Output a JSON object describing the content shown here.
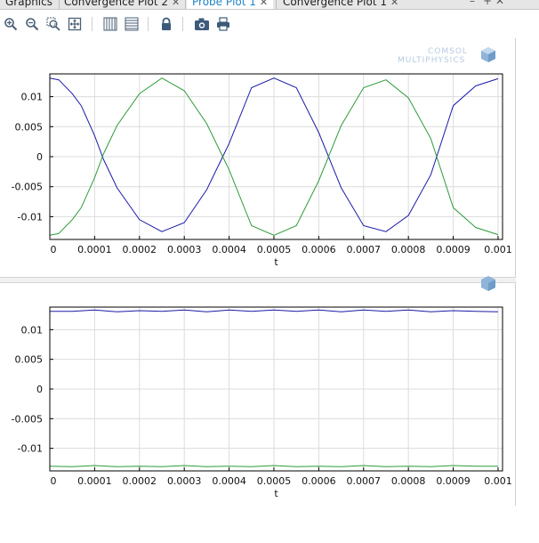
{
  "tabs": [
    {
      "label": "Graphics",
      "closable": false,
      "active": false
    },
    {
      "label": "Convergence Plot 2",
      "closable": true,
      "active": false
    },
    {
      "label": "Probe Plot 1",
      "closable": true,
      "active": true
    },
    {
      "label": "Convergence Plot 1",
      "closable": true,
      "active": false
    }
  ],
  "toolbar": {
    "icons": [
      "zoom-in-icon",
      "zoom-out-icon",
      "zoom-box-icon",
      "zoom-extents-icon",
      "x-grid-icon",
      "y-grid-icon",
      "lock-icon",
      "camera-icon",
      "print-icon"
    ]
  },
  "logo": {
    "line1": "COMSOL",
    "line2": "MULTIPHYSICS"
  },
  "colors": {
    "series1": "#1a1aa8",
    "series2": "#2e9b3a",
    "grid": "#dcdcdc",
    "accent": "#1d83c5"
  },
  "chart_data": [
    {
      "type": "line",
      "xlabel": "t",
      "ylabel": "",
      "xlim": [
        0,
        0.00101
      ],
      "ylim": [
        -0.0138,
        0.0138
      ],
      "xticks": [
        "0",
        "0.0001",
        "0.0002",
        "0.0003",
        "0.0004",
        "0.0005",
        "0.0006",
        "0.0007",
        "0.0008",
        "0.0009",
        "0.001"
      ],
      "yticks": [
        "0.01",
        "0.005",
        "0",
        "-0.005",
        "-0.01"
      ],
      "grid": true,
      "x": [
        0,
        2e-05,
        5e-05,
        7e-05,
        0.0001,
        0.00012,
        0.00015,
        0.0002,
        0.00025,
        0.0003,
        0.00035,
        0.0004,
        0.00045,
        0.0005,
        0.00055,
        0.0006,
        0.00065,
        0.0007,
        0.00075,
        0.0008,
        0.00085,
        0.0009,
        0.00095,
        0.001
      ],
      "series": [
        {
          "name": "",
          "color": "#1a1aa8",
          "values": [
            0.0131,
            0.0128,
            0.0105,
            0.0085,
            0.0035,
            -0.0005,
            -0.0052,
            -0.0105,
            -0.0125,
            -0.011,
            -0.0055,
            0.0022,
            0.0115,
            0.0131,
            0.0115,
            0.004,
            -0.0052,
            -0.0115,
            -0.0125,
            -0.0098,
            -0.003,
            0.0085,
            0.0118,
            0.013
          ]
        },
        {
          "name": "",
          "color": "#2e9b3a",
          "values": [
            -0.0131,
            -0.0128,
            -0.0105,
            -0.0085,
            -0.0035,
            0.0005,
            0.0052,
            0.0105,
            0.0131,
            0.011,
            0.0055,
            -0.0022,
            -0.0115,
            -0.0131,
            -0.0115,
            -0.004,
            0.0052,
            0.0115,
            0.0128,
            0.0098,
            0.003,
            -0.0085,
            -0.0118,
            -0.013
          ]
        }
      ]
    },
    {
      "type": "line",
      "xlabel": "t",
      "ylabel": "",
      "xlim": [
        0,
        0.00101
      ],
      "ylim": [
        -0.0138,
        0.0138
      ],
      "xticks": [
        "0",
        "0.0001",
        "0.0002",
        "0.0003",
        "0.0004",
        "0.0005",
        "0.0006",
        "0.0007",
        "0.0008",
        "0.0009",
        "0.001"
      ],
      "yticks": [
        "0.01",
        "0.005",
        "0",
        "-0.005",
        "-0.01"
      ],
      "grid": true,
      "x": [
        0,
        5e-05,
        0.0001,
        0.00015,
        0.0002,
        0.00025,
        0.0003,
        0.00035,
        0.0004,
        0.00045,
        0.0005,
        0.00055,
        0.0006,
        0.00065,
        0.0007,
        0.00075,
        0.0008,
        0.00085,
        0.0009,
        0.00095,
        0.001
      ],
      "series": [
        {
          "name": "",
          "color": "#1a1aa8",
          "values": [
            0.0131,
            0.0131,
            0.0133,
            0.013,
            0.0132,
            0.0131,
            0.0133,
            0.013,
            0.0133,
            0.0131,
            0.0133,
            0.0131,
            0.0133,
            0.013,
            0.0133,
            0.0131,
            0.0133,
            0.013,
            0.0132,
            0.0131,
            0.013
          ]
        },
        {
          "name": "",
          "color": "#2e9b3a",
          "values": [
            -0.013,
            -0.0131,
            -0.0129,
            -0.0131,
            -0.013,
            -0.0131,
            -0.0129,
            -0.0131,
            -0.013,
            -0.0131,
            -0.0129,
            -0.0131,
            -0.013,
            -0.0131,
            -0.0129,
            -0.0131,
            -0.013,
            -0.0131,
            -0.0129,
            -0.013,
            -0.013
          ]
        }
      ]
    }
  ]
}
